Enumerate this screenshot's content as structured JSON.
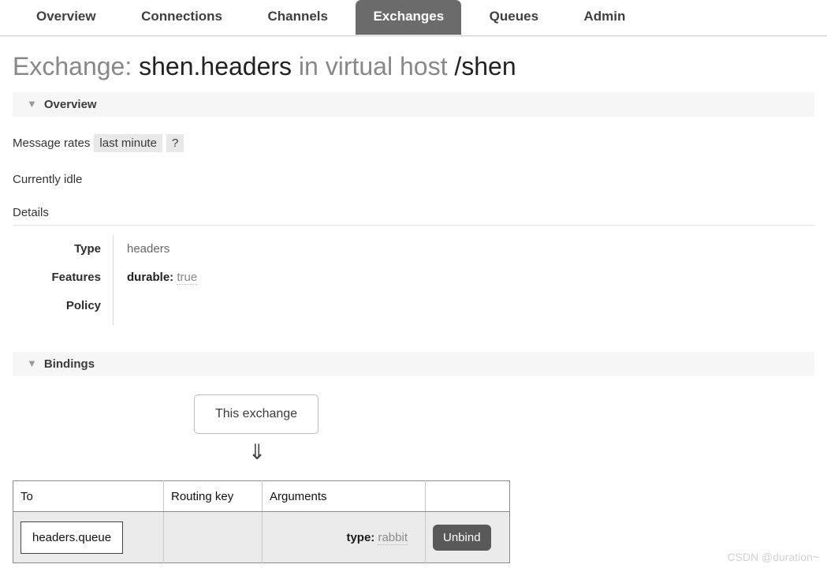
{
  "nav": {
    "tabs": [
      {
        "label": "Overview",
        "active": false
      },
      {
        "label": "Connections",
        "active": false
      },
      {
        "label": "Channels",
        "active": false
      },
      {
        "label": "Exchanges",
        "active": true
      },
      {
        "label": "Queues",
        "active": false
      },
      {
        "label": "Admin",
        "active": false
      }
    ],
    "active_tab_bg": "#6b6b6b"
  },
  "title": {
    "prefix": "Exchange:",
    "exchange_name": "shen.headers",
    "middle": "in virtual host",
    "vhost": "/shen"
  },
  "overview": {
    "header": "Overview",
    "collapse_icon": "▼",
    "rates_label": "Message rates",
    "rates_period": "last minute",
    "help_badge": "?",
    "status": "Currently idle",
    "details_label": "Details",
    "details": [
      {
        "label": "Type",
        "value": "headers",
        "key": "",
        "val": ""
      },
      {
        "label": "Features",
        "value": "",
        "key": "durable:",
        "val": "true"
      },
      {
        "label": "Policy",
        "value": "",
        "key": "",
        "val": ""
      }
    ]
  },
  "bindings": {
    "header": "Bindings",
    "collapse_icon": "▼",
    "this_exchange_label": "This exchange",
    "arrow_glyph": "⇓",
    "columns": [
      "To",
      "Routing key",
      "Arguments",
      ""
    ],
    "rows": [
      {
        "to": "headers.queue",
        "routing_key": "",
        "arg_key": "type:",
        "arg_val": "rabbit",
        "action": "Unbind"
      }
    ]
  },
  "watermark": "CSDN @duration~"
}
